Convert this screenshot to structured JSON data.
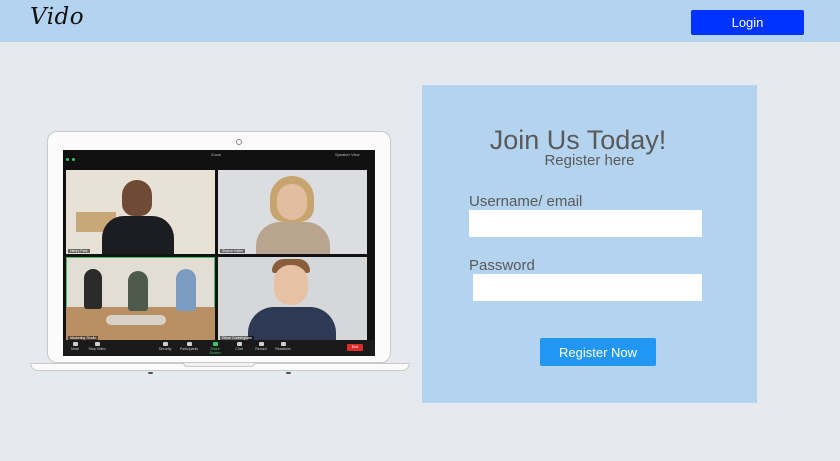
{
  "header": {
    "logo": "Vido",
    "login_label": "Login",
    "background": "#b3d3ef",
    "login_color": "#0033ff"
  },
  "hero_image": {
    "window_title": "Zoom",
    "view_mode": "Speaker View",
    "participants": [
      {
        "name": "Henry Park"
      },
      {
        "name": "Sharon Keller"
      },
      {
        "name": "Marketing Studio"
      },
      {
        "name": "Ethan Cunningham"
      }
    ],
    "toolbar": [
      {
        "label": "Mute"
      },
      {
        "label": "Stop Video"
      },
      {
        "label": "Security"
      },
      {
        "label": "Participants"
      },
      {
        "label": "Share Screen"
      },
      {
        "label": "Chat"
      },
      {
        "label": "Record"
      },
      {
        "label": "Reactions"
      }
    ],
    "end_label": "End"
  },
  "register": {
    "title": "Join Us Today!",
    "subtitle": "Register here",
    "username_label": "Username/ email",
    "username_value": "",
    "password_label": "Password",
    "password_value": "",
    "submit_label": "Register Now",
    "background": "#b3d3ef",
    "button_color": "#2196f3"
  }
}
